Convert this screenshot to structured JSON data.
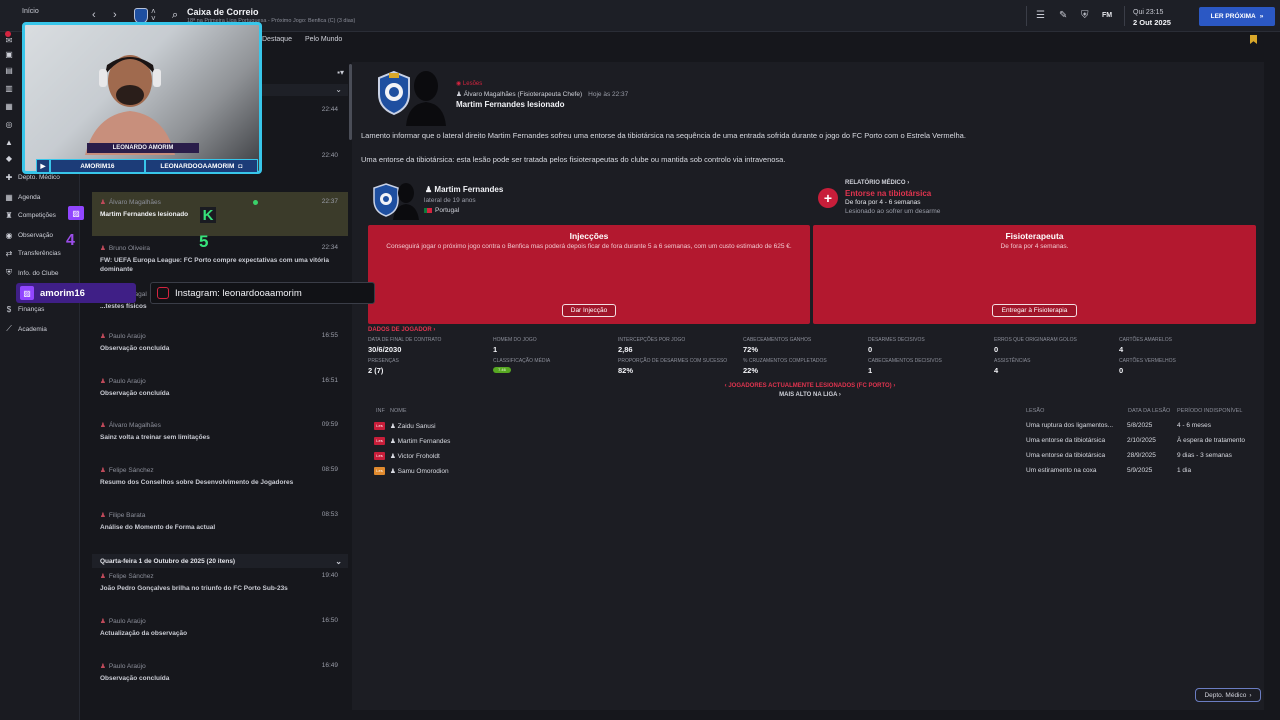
{
  "topbar": {
    "home_label": "Início",
    "channel_hint": "Ch",
    "title": "Caixa de Correio",
    "subtitle": "18ª na Primeira Liga Portuguesa - Próximo Jogo: Benfica (C) (3 dias)",
    "fm_label": "FM",
    "day_time": "Qui 23:15",
    "date": "2 Out 2025",
    "next_button": "LER PRÓXIMA"
  },
  "tabs": [
    "Destaque",
    "Pelo Mundo"
  ],
  "leftnav": [
    {
      "label": "Depto. Médico",
      "icon": "medical-icon"
    },
    {
      "label": "Agenda",
      "icon": "calendar-icon"
    },
    {
      "label": "Competições",
      "icon": "trophy-icon"
    },
    {
      "label": "Observação",
      "icon": "scouting-icon"
    },
    {
      "label": "Transferências",
      "icon": "transfer-icon"
    },
    {
      "label": "Info. do Clube",
      "icon": "club-icon"
    },
    {
      "label": "Finanças",
      "icon": "finance-icon"
    },
    {
      "label": "Academia",
      "icon": "academy-icon"
    }
  ],
  "inbox": {
    "items": [
      {
        "sender": "",
        "time": "22:44",
        "subject": ""
      },
      {
        "sender": "",
        "time": "22:40",
        "subject": ""
      },
      {
        "sender": "Álvaro Magalhães",
        "time": "22:37",
        "subject": "Martim Fernandes lesionado",
        "selected": true
      },
      {
        "sender": "Bruno Oliveira",
        "time": "22:34",
        "subject": "FW: UEFA Europa League: FC Porto compre expectativas com uma vitória dominante"
      },
      {
        "sender": "Álvaro Magal",
        "time": "",
        "subject": "...testes físicos"
      },
      {
        "sender": "Paulo Araújo",
        "time": "16:55",
        "subject": "Observação concluída"
      },
      {
        "sender": "Paulo Araújo",
        "time": "16:51",
        "subject": "Observação concluída"
      },
      {
        "sender": "Álvaro Magalhães",
        "time": "09:59",
        "subject": "Sainz volta a treinar sem limitações"
      },
      {
        "sender": "Felipe Sánchez",
        "time": "08:59",
        "subject": "Resumo dos Conselhos sobre Desenvolvimento de Jogadores"
      },
      {
        "sender": "Filipe Barata",
        "time": "08:53",
        "subject": "Análise do Momento de Forma actual"
      }
    ],
    "day_header": "Quarta-feira 1 de Outubro de 2025 (20 itens)",
    "items2": [
      {
        "sender": "Felipe Sánchez",
        "time": "19:40",
        "subject": "João Pedro Gonçalves brilha no triunfo do FC Porto Sub-23s"
      },
      {
        "sender": "Paulo Araújo",
        "time": "16:50",
        "subject": "Actualização da observação"
      },
      {
        "sender": "Paulo Araújo",
        "time": "16:49",
        "subject": "Observação concluída"
      }
    ]
  },
  "message": {
    "category": "Lesões",
    "from": "Álvaro Magalhães (Fisioterapeuta Chefe)",
    "when": "Hoje às 22:37",
    "subject": "Martim Fernandes lesionado",
    "para1": "Lamento informar que o lateral direito Martim Fernandes sofreu uma entorse da tibiotársica na sequência de uma entrada sofrida durante o jogo do FC Porto com o Estrela Vermelha.",
    "para2": "Uma entorse da tibiotársica: esta lesão pode ser tratada pelos fisioterapeutas do clube ou mantida sob controlo via intravenosa."
  },
  "player": {
    "name": "Martim Fernandes",
    "age": "lateral de 19 anos",
    "country": "Portugal"
  },
  "medical": {
    "label": "RELATÓRIO MÉDICO",
    "injury": "Entorse na tibiotársica",
    "out": "De fora por 4 - 6 semanas",
    "how": "Lesionado ao sofrer um desarme"
  },
  "options": {
    "injection": {
      "title": "Injecções",
      "desc": "Conseguirá jogar o próximo jogo contra o Benfica mas poderá depois ficar de fora durante 5 a 6 semanas, com um custo estimado de 625 €.",
      "button": "Dar Injecção"
    },
    "physio": {
      "title": "Fisioterapeuta",
      "desc": "De fora por 4 semanas.",
      "button": "Entregar à Fisioterapia"
    }
  },
  "stats_label": "DADOS DE JOGADOR",
  "stats": [
    {
      "label": "DATA DE FINAL DE CONTRATO",
      "value": "30/6/2030"
    },
    {
      "label": "HOMEM DO JOGO",
      "value": "1"
    },
    {
      "label": "INTERCEPÇÕES POR JOGO",
      "value": "2,86"
    },
    {
      "label": "CABECEAMENTOS GANHOS",
      "value": "72%"
    },
    {
      "label": "DESARMES DECISIVOS",
      "value": "0"
    },
    {
      "label": "ERROS QUE ORIGINARAM GOLOS",
      "value": "0"
    },
    {
      "label": "CARTÕES AMARELOS",
      "value": "4"
    },
    {
      "label": "PRESENÇAS",
      "value": "2 (7)"
    },
    {
      "label": "CLASSIFICAÇÃO MÉDIA",
      "value": "7.46"
    },
    {
      "label": "PROPORÇÃO DE DESARMES COM SUCESSO",
      "value": "82%"
    },
    {
      "label": "% CRUZAMENTOS COMPLETADOS",
      "value": "22%"
    },
    {
      "label": "CABECEAMENTOS DECISIVOS",
      "value": "1"
    },
    {
      "label": "ASSISTÊNCIAS",
      "value": "4"
    },
    {
      "label": "CARTÕES VERMELHOS",
      "value": "0"
    }
  ],
  "injured": {
    "header": "JOGADORES ACTUALMENTE LESIONADOS (FC PORTO)",
    "sub": "MAIS ALTO NA LIGA",
    "columns": [
      "INF",
      "NOME",
      "LESÃO",
      "DATA DA LESÃO",
      "PERÍODO INDISPONÍVEL"
    ],
    "rows": [
      {
        "tag": "Les",
        "name": "Zaidu Sanusi",
        "injury": "Uma ruptura dos ligamentos...",
        "date": "5/8/2025",
        "period": "4 - 6 meses",
        "color": "#c81e3a"
      },
      {
        "tag": "Les",
        "name": "Martim Fernandes",
        "injury": "Uma entorse da tibiotársica",
        "date": "2/10/2025",
        "period": "À espera de tratamento",
        "color": "#c81e3a"
      },
      {
        "tag": "Les",
        "name": "Victor Froholdt",
        "injury": "Uma entorse da tibiotársica",
        "date": "28/9/2025",
        "period": "9 dias - 3 semanas",
        "color": "#c81e3a"
      },
      {
        "tag": "Les",
        "name": "Samu Omorodion",
        "injury": "Um estiramento na coxa",
        "date": "5/9/2025",
        "period": "1 dia",
        "color": "#e08a2e"
      }
    ]
  },
  "footer_button": "Depto. Médico",
  "overlay": {
    "cam_name": "LEONARDO AMORIM",
    "yt_name": "AMORIM16",
    "ig_name": "LEONARDOOAAMORIM",
    "k_badge": "K",
    "num5": "5",
    "num4": "4",
    "twitch_name": "amorim16",
    "instagram": "Instagram: leonardooaamorim"
  }
}
